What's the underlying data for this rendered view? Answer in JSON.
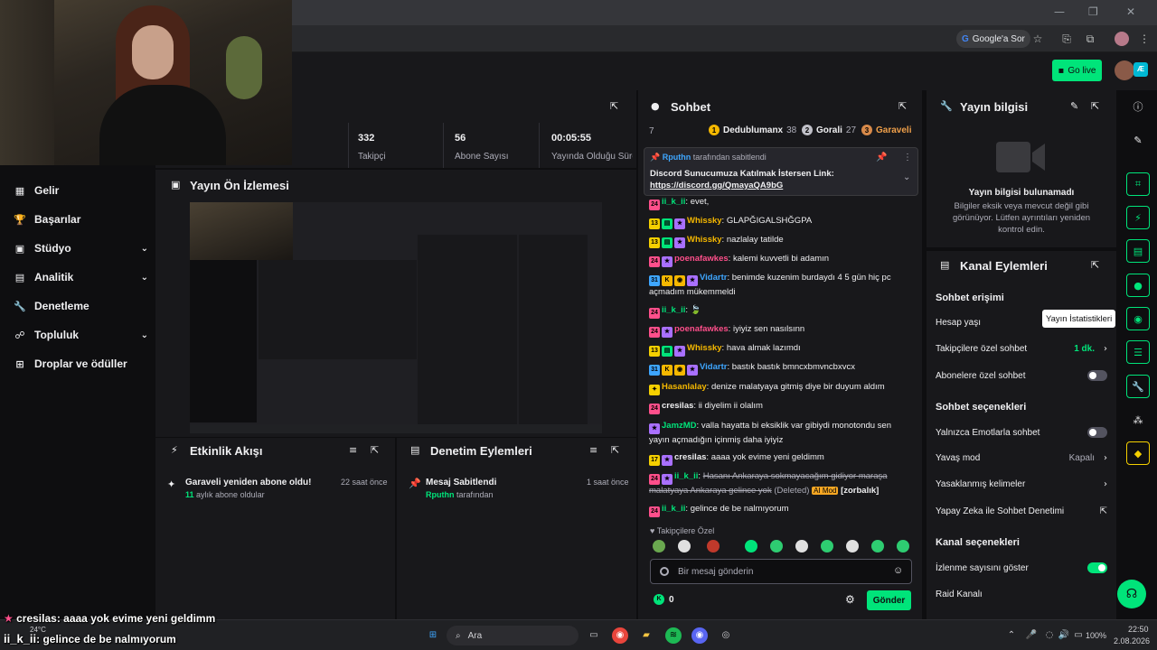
{
  "browser": {
    "google_btn": "Google'a Sor",
    "window_controls": [
      "—",
      "❐",
      "✕"
    ]
  },
  "topnav": {
    "go_live": "Go live"
  },
  "sidebar": {
    "items": [
      {
        "label": "Gelir",
        "icon": "▦",
        "has_chevron": false
      },
      {
        "label": "Başarılar",
        "icon": "🏆",
        "has_chevron": false
      },
      {
        "label": "Stüdyo",
        "icon": "▣",
        "has_chevron": true
      },
      {
        "label": "Analitik",
        "icon": "▤",
        "has_chevron": true
      },
      {
        "label": "Denetleme",
        "icon": "🔧",
        "has_chevron": false
      },
      {
        "label": "Topluluk",
        "icon": "☍",
        "has_chevron": true
      },
      {
        "label": "Droplar ve ödüller",
        "icon": "⊞",
        "has_chevron": false
      }
    ],
    "chevron": "⌄"
  },
  "stats": [
    {
      "value": "332",
      "label": "Takipçi"
    },
    {
      "value": "56",
      "label": "Abone Sayısı"
    },
    {
      "value": "00:05:55",
      "label": "Yayında Olduğu Süre"
    }
  ],
  "preview": {
    "title": "Yayın Ön İzlemesi"
  },
  "events": {
    "title": "Etkinlik Akışı",
    "items": [
      {
        "title": "Garaveli yeniden abone oldu!",
        "time": "22 saat önce",
        "count": "11",
        "sub": "aylık abone oldular"
      }
    ]
  },
  "moderation": {
    "title": "Denetim Eylemleri",
    "items": [
      {
        "title": "Mesaj Sabitlendi",
        "time": "1 saat önce",
        "user": "Rputhn",
        "sub": "tarafından"
      }
    ]
  },
  "chat": {
    "title": "Sohbet",
    "leader_count": "7",
    "leaders": [
      {
        "rank": "1",
        "name": "Dedublumanx",
        "score": "38",
        "color": "#f5b800"
      },
      {
        "rank": "2",
        "name": "Gorali",
        "score": "27",
        "color": "#c0c0c8"
      },
      {
        "rank": "3",
        "name": "Garaveli",
        "score": "",
        "color": "#d88a4a"
      }
    ],
    "pinned": {
      "by_user": "Rputhn",
      "by_text": "tarafından sabitlendi",
      "text": "Discord Sunucumuza Katılmak İstersen Link:",
      "link": "https://discord.gg/QmayaQA9bG"
    },
    "messages": [
      {
        "badges": [
          "24"
        ],
        "user": "ii_k_ii",
        "color": "#00e47a",
        "text": "evet,",
        "strike": false
      },
      {
        "badges": [
          "13",
          "▤",
          "★"
        ],
        "user": "Whissky",
        "color": "#f5b800",
        "text": "GLAPĞIGALSHĞGPA",
        "strike": false
      },
      {
        "badges": [
          "13",
          "▤",
          "★"
        ],
        "user": "Whissky",
        "color": "#f5b800",
        "text": "nazlalay tatilde",
        "strike": false
      },
      {
        "badges": [
          "24",
          "★"
        ],
        "user": "poenafawkes",
        "color": "#ff4f8b",
        "text": "kalemi kuvvetli bi adamın",
        "strike": false
      },
      {
        "badges": [
          "31",
          "K",
          "◉",
          "★"
        ],
        "user": "Vidartr",
        "color": "#3ea6ff",
        "text": "benimde kuzenim burdaydı 4 5 gün hiç pc açmadım mükemmeldi",
        "strike": false
      },
      {
        "badges": [
          "24"
        ],
        "user": "ii_k_ii",
        "color": "#00e47a",
        "text": "🍃",
        "strike": false
      },
      {
        "badges": [
          "24",
          "★"
        ],
        "user": "poenafawkes",
        "color": "#ff4f8b",
        "text": "iyiyiz sen nasılsınn",
        "strike": false
      },
      {
        "badges": [
          "13",
          "▤",
          "★"
        ],
        "user": "Whissky",
        "color": "#f5b800",
        "text": "hava almak lazımdı",
        "strike": false
      },
      {
        "badges": [
          "31",
          "K",
          "◉",
          "★"
        ],
        "user": "Vidartr",
        "color": "#3ea6ff",
        "text": "bastık bastık bmncxbmvncbxvcx",
        "strike": false
      },
      {
        "badges": [
          "✦"
        ],
        "user": "Hasanlalay",
        "color": "#f5b800",
        "text": "denize malatyaya gitmiş diye bir duyum aldım",
        "strike": false
      },
      {
        "badges": [
          "24"
        ],
        "user": "cresilas",
        "color": "#efeff1",
        "text": "ii diyelim ii olalım",
        "strike": false
      },
      {
        "badges": [
          "★"
        ],
        "user": "JamzMD",
        "color": "#00e47a",
        "text": "valla hayatta bi eksiklik var gibiydi monotondu sen yayın açmadığın içinmiş daha iyiyiz",
        "strike": false
      },
      {
        "badges": [
          "17",
          "★"
        ],
        "user": "cresilas",
        "color": "#efeff1",
        "text": "aaaa yok evime yeni geldimm",
        "strike": false
      },
      {
        "badges": [
          "24",
          "★"
        ],
        "user": "ii_k_ii",
        "color": "#00e47a",
        "text": "Hasanı Ankaraya sokmayacağım gidiyor maraşa malatyaya Ankaraya gelince yok",
        "strike": true,
        "deleted": "(Deleted)",
        "mod_tag": "AI Mod",
        "reason": "[zorbalık]"
      },
      {
        "badges": [
          "24"
        ],
        "user": "ii_k_ii",
        "color": "#00e47a",
        "text": "gelince de be nalmıyorum",
        "strike": false
      }
    ],
    "followers_only": "Takipçilere Özel",
    "input_placeholder": "Bir mesaj gönderin",
    "points": "0",
    "send": "Gönder"
  },
  "stream_info": {
    "title": "Yayın bilgisi",
    "empty_title": "Yayın bilgisi bulunamadı",
    "empty_body": "Bilgiler eksik veya mevcut değil gibi görünüyor. Lütfen ayrıntıları yeniden kontrol edin."
  },
  "channel_actions": {
    "title": "Kanal Eylemleri",
    "chat_access": "Sohbet erişimi",
    "account_age": "Hesap yaşı",
    "followers_chat": "Takipçilere özel sohbet",
    "followers_chat_value": "1 dk.",
    "subs_chat": "Abonelere özel sohbet",
    "chat_options": "Sohbet seçenekleri",
    "emote_only": "Yalnızca Emotlarla sohbet",
    "slow_mode": "Yavaş mod",
    "slow_mode_value": "Kapalı",
    "banned_words": "Yasaklanmış kelimeler",
    "ai_moderation": "Yapay Zeka ile Sohbet Denetimi",
    "channel_options": "Kanal seçenekleri",
    "show_viewers": "İzlenme sayısını göster",
    "raid_channel": "Raid Kanalı",
    "tooltip": "Yayın İstatistikleri"
  },
  "overlay": {
    "line1_user": "cresilas",
    "line1_text": ": aaaa yok evime yeni geldimm",
    "line2_user": "ii_k_ii",
    "line2_text": ": gelince de be nalmıyorum"
  },
  "taskbar": {
    "search": "Ara",
    "weather": "24°C",
    "battery": "100%",
    "time": "22:50",
    "date": "2.08.2026"
  },
  "colors": {
    "accent": "#00e47a",
    "panel": "#18181b",
    "bg": "#0e0e10"
  }
}
